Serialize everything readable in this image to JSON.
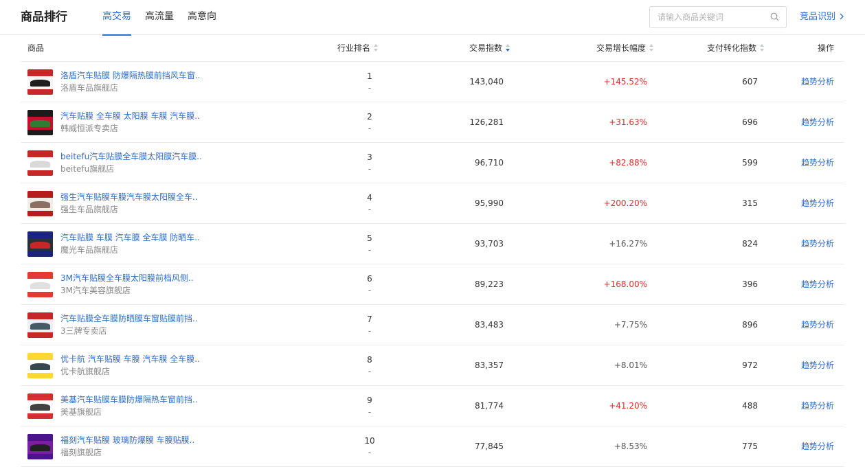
{
  "header": {
    "title": "商品排行",
    "tabs": [
      {
        "label": "高交易",
        "active": true
      },
      {
        "label": "高流量",
        "active": false
      },
      {
        "label": "高意向",
        "active": false
      }
    ],
    "search_placeholder": "请输入商品关键词",
    "search_icon": "search-icon",
    "compete_link": "竞品识别",
    "accent_color": "#2e6ccf"
  },
  "columns": {
    "product": "商品",
    "rank": "行业排名",
    "trade": "交易指数",
    "growth": "交易增长幅度",
    "conversion": "支付转化指数",
    "action": "操作",
    "sorted_column": "trade",
    "sort_order": "desc"
  },
  "colors": {
    "growth_up": "#e12b2b",
    "growth_normal": "#555555",
    "link": "#2e6ccf"
  },
  "rows": [
    {
      "name": "洛盾汽车贴膜 防爆隔热膜前挡风车窗..",
      "shop": "洛盾车品旗舰店",
      "rank": "1",
      "rank_change": "-",
      "trade": "143,040",
      "growth": "+145.52%",
      "highlight": true,
      "conversion": "607",
      "action": "趋势分析"
    },
    {
      "name": "汽车贴膜 全车膜 太阳膜 车膜 汽车膜..",
      "shop": "韩威恒派专卖店",
      "rank": "2",
      "rank_change": "-",
      "trade": "126,281",
      "growth": "+31.63%",
      "highlight": true,
      "conversion": "696",
      "action": "趋势分析"
    },
    {
      "name": "beitefu汽车贴膜全车膜太阳膜汽车膜..",
      "shop": "beitefu旗舰店",
      "rank": "3",
      "rank_change": "-",
      "trade": "96,710",
      "growth": "+82.88%",
      "highlight": true,
      "conversion": "599",
      "action": "趋势分析"
    },
    {
      "name": "强生汽车贴膜车膜汽车膜太阳膜全车..",
      "shop": "强生车品旗舰店",
      "rank": "4",
      "rank_change": "-",
      "trade": "95,990",
      "growth": "+200.20%",
      "highlight": true,
      "conversion": "315",
      "action": "趋势分析"
    },
    {
      "name": "汽车贴膜 车膜 汽车膜 全车膜 防晒车..",
      "shop": "魔光车品旗舰店",
      "rank": "5",
      "rank_change": "-",
      "trade": "93,703",
      "growth": "+16.27%",
      "highlight": false,
      "conversion": "824",
      "action": "趋势分析"
    },
    {
      "name": "3M汽车贴膜全车膜太阳膜前档风侧..",
      "shop": "3M汽车美容旗舰店",
      "rank": "6",
      "rank_change": "-",
      "trade": "89,223",
      "growth": "+168.00%",
      "highlight": true,
      "conversion": "396",
      "action": "趋势分析"
    },
    {
      "name": "汽车贴膜全车膜防晒膜车窗贴膜前挡..",
      "shop": "3三牌专卖店",
      "rank": "7",
      "rank_change": "-",
      "trade": "83,483",
      "growth": "+7.75%",
      "highlight": false,
      "conversion": "896",
      "action": "趋势分析"
    },
    {
      "name": "优卡航 汽车贴膜 车膜 汽车膜 全车膜..",
      "shop": "优卡航旗舰店",
      "rank": "8",
      "rank_change": "-",
      "trade": "83,357",
      "growth": "+8.01%",
      "highlight": false,
      "conversion": "972",
      "action": "趋势分析"
    },
    {
      "name": "美基汽车贴膜车膜防爆隔热车窗前挡..",
      "shop": "美基旗舰店",
      "rank": "9",
      "rank_change": "-",
      "trade": "81,774",
      "growth": "+41.20%",
      "highlight": true,
      "conversion": "488",
      "action": "趋势分析"
    },
    {
      "name": "福刻汽车贴膜 玻璃防爆膜 车膜贴膜..",
      "shop": "福刻旗舰店",
      "rank": "10",
      "rank_change": "-",
      "trade": "77,845",
      "growth": "+8.53%",
      "highlight": false,
      "conversion": "775",
      "action": "趋势分析"
    }
  ]
}
